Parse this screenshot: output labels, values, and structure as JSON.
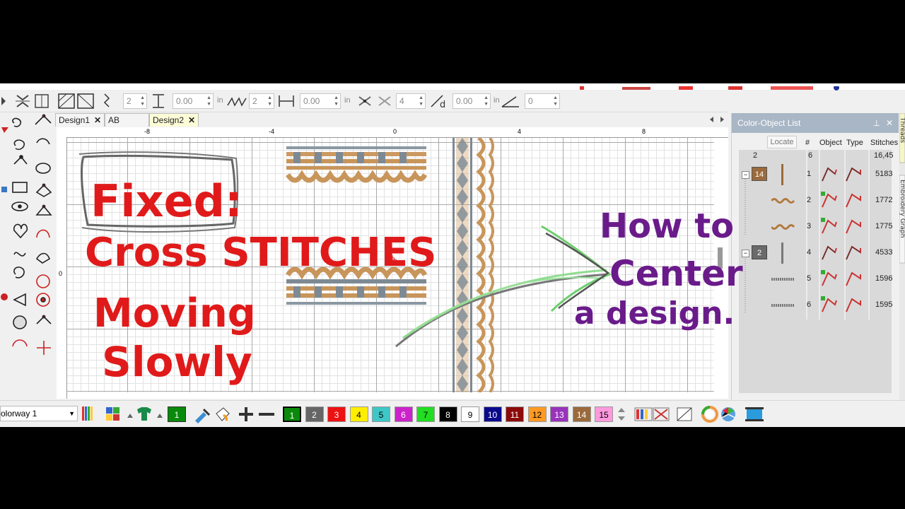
{
  "tabs": [
    {
      "label": "Design1",
      "close": "✕"
    },
    {
      "label": "AB kay",
      "close": "✕"
    },
    {
      "label": "Design2",
      "close": "✕"
    }
  ],
  "toolbar": {
    "fields": [
      {
        "value": "2"
      },
      {
        "value": "0.00",
        "unit": "in"
      },
      {
        "value": "2"
      },
      {
        "value": "0.00",
        "unit": "in"
      },
      {
        "value": "4"
      },
      {
        "value": "0.00",
        "unit": "in"
      },
      {
        "value": "0"
      }
    ]
  },
  "ruler": {
    "top_labels": [
      "-8",
      "-4",
      "0",
      "4",
      "8"
    ],
    "left_label": "0"
  },
  "panel": {
    "title": "Color-Object List",
    "locate": "Locate",
    "headers": {
      "num": "#",
      "object": "Object",
      "type": "Type",
      "stitches": "Stitches"
    },
    "summary": {
      "colors": "2",
      "objects": "6",
      "stitches": "16,45"
    },
    "groups": [
      {
        "color_no": "14",
        "color": "#9b6a3c"
      },
      {
        "color_no": "2",
        "color": "#6a6a6a"
      }
    ],
    "rows": [
      {
        "num": "1",
        "stitches": "5183"
      },
      {
        "num": "2",
        "stitches": "1772"
      },
      {
        "num": "3",
        "stitches": "1775"
      },
      {
        "num": "4",
        "stitches": "4533"
      },
      {
        "num": "5",
        "stitches": "1596"
      },
      {
        "num": "6",
        "stitches": "1595"
      }
    ],
    "side_tabs": [
      "Threads",
      "Embroidery Graph"
    ]
  },
  "bottom": {
    "colorway": "olorway 1",
    "current_color": "1",
    "swatches": [
      {
        "label": "1",
        "color": "#0a8a0a"
      },
      {
        "label": "2",
        "color": "#666666"
      },
      {
        "label": "3",
        "color": "#ee1111"
      },
      {
        "label": "4",
        "color": "#ffee00"
      },
      {
        "label": "5",
        "color": "#3ec7c7"
      },
      {
        "label": "6",
        "color": "#cc22cc"
      },
      {
        "label": "7",
        "color": "#22dd22"
      },
      {
        "label": "8",
        "color": "#000000"
      },
      {
        "label": "9",
        "color": "#ffffff"
      },
      {
        "label": "10",
        "color": "#0a0a8c"
      },
      {
        "label": "11",
        "color": "#8c0a0a"
      },
      {
        "label": "12",
        "color": "#ff9922"
      },
      {
        "label": "13",
        "color": "#9933bb"
      },
      {
        "label": "14",
        "color": "#9b6a3c"
      },
      {
        "label": "15",
        "color": "#ff99dd"
      }
    ]
  },
  "annotations": {
    "red_lines": [
      "Fixed:",
      "Cross STITCHES",
      "Moving",
      "Slowly"
    ],
    "purple_lines": [
      "How to",
      "Center",
      "a design."
    ]
  },
  "colors": {
    "red_ink": "#e01a1a",
    "purple_ink": "#6a1b8a",
    "tan_stitch": "#c8955a",
    "gray_stitch": "#7d8a94",
    "panel_title": "#a9b6c6"
  }
}
